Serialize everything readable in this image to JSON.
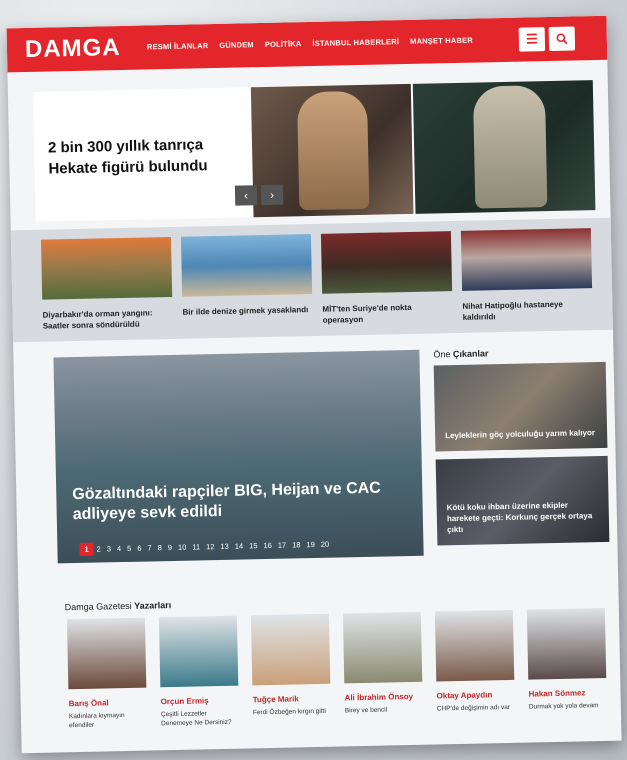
{
  "nav": {
    "logo": "DAMGA",
    "menu": [
      "RESMİ İLANLAR",
      "GÜNDEM",
      "POLİTİKA",
      "İSTANBUL HABERLERİ",
      "MANŞET HABER"
    ],
    "menu_icon": "hamburger-icon",
    "search_icon": "search-icon"
  },
  "hero": {
    "title": "2 bin 300 yıllık tanrıça Hekate figürü bulundu",
    "prev": "‹",
    "next": "›"
  },
  "cards": [
    {
      "title": "Diyarbakır'da orman yangını: Saatler sonra söndürüldü"
    },
    {
      "title": "Bir ilde denize girmek yasaklandı"
    },
    {
      "title": "MİT'ten Suriye'de nokta operasyon"
    },
    {
      "title": "Nihat Hatipoğlu hastaneye kaldırıldı"
    }
  ],
  "main": {
    "title": "Gözaltındaki rapçiler BIG, Heijan ve CAC adliyeye sevk edildi",
    "pages": [
      "1",
      "2",
      "3",
      "4",
      "5",
      "6",
      "7",
      "8",
      "9",
      "10",
      "11",
      "12",
      "13",
      "14",
      "15",
      "16",
      "17",
      "18",
      "19",
      "20"
    ],
    "active_page": "1"
  },
  "one_cikanlar": {
    "title_a": "Öne",
    "title_b": "Çıkanlar",
    "items": [
      {
        "title": "Leyleklerin göç yolculuğu yarım kalıyor"
      },
      {
        "title": "Kötü koku ihbarı üzerine ekipler harekete geçti: Korkunç gerçek ortaya çıktı"
      }
    ]
  },
  "writers_section": {
    "title_a": "Damga Gazetesi",
    "title_b": "Yazarları",
    "writers": [
      {
        "name": "Barış Önal",
        "article": "Kadınlara kıymayın efendiler"
      },
      {
        "name": "Orçun Ermiş",
        "article": "Çeşitli Lezzetler Denemeye Ne Dersiniz?"
      },
      {
        "name": "Tuğçe Marik",
        "article": "Ferdi Özbeğen kırgın gitti"
      },
      {
        "name": "Ali İbrahim Önsoy",
        "article": "Birey ve bencil"
      },
      {
        "name": "Oktay Apaydın",
        "article": "CHP'de değişimin adı var"
      },
      {
        "name": "Hakan Sönmez",
        "article": "Durmak yok yola devam"
      }
    ]
  }
}
